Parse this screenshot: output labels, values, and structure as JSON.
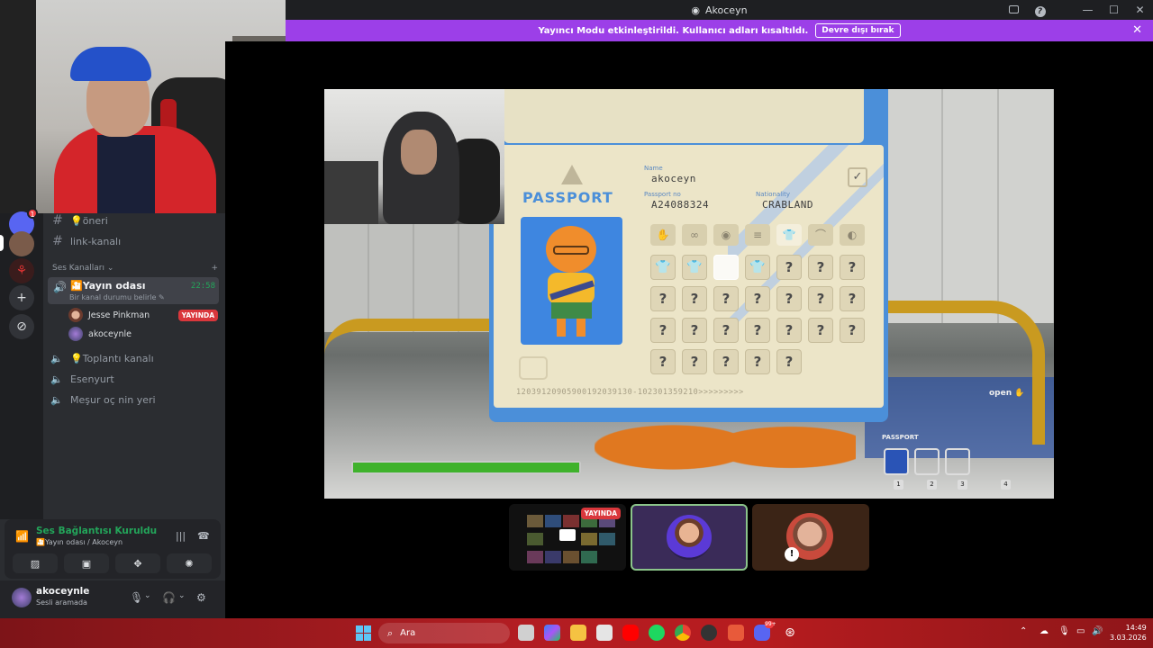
{
  "window": {
    "title": "Akoceyn",
    "banner_text": "Yayıncı Modu etkinleştirildi. Kullanıcı adları kısaltıldı.",
    "banner_button": "Devre dışı bırak"
  },
  "servers": {
    "badge_count": "1"
  },
  "channels": {
    "text_items": [
      {
        "label": "💡öneri"
      },
      {
        "label": "link-kanalı"
      }
    ],
    "voice_section": "Ses Kanalları",
    "active": {
      "name": "🎦Yayın odası",
      "status": "Bir kanal durumu belirle",
      "timer": "22:58"
    },
    "members": [
      {
        "name": "Jesse Pinkman",
        "badge": "YAYINDA"
      },
      {
        "name": "akoceynle",
        "badge": ""
      }
    ],
    "other_voice": [
      {
        "label": "💡Toplantı kanalı"
      },
      {
        "label": "Esenyurt"
      },
      {
        "label": "Meşur oç nin yeri"
      }
    ]
  },
  "voice_panel": {
    "title": "Ses Bağlantısı Kuruldu",
    "subtitle": "🎦Yayın odası / Akoceyn"
  },
  "user": {
    "name": "akoceynle",
    "status": "Sesli aramada"
  },
  "game": {
    "passport": {
      "title": "PASSPORT",
      "name_label": "Name",
      "name_value": "akoceyn",
      "passport_no_label": "Passport no",
      "passport_no_value": "A24088324",
      "nationality_label": "Nationality",
      "nationality_value": "CRABLAND",
      "number_strip": "12039120905900192039130-102301359210>>>>>>>>>"
    },
    "hud": {
      "open_label": "open",
      "passport_label": "PASSPORT",
      "slots": [
        "1",
        "2",
        "3",
        "4"
      ],
      "progress": 1.0
    }
  },
  "stream_tiles": {
    "live_badge": "YAYINDA"
  },
  "taskbar": {
    "search_placeholder": "Ara",
    "time": "14:49",
    "date": "3.03.2026",
    "discord_badge": "99+"
  },
  "colors": {
    "banner": "#9c3fe8",
    "discord_green": "#23a55a",
    "live_red": "#da373c",
    "passport_blue": "#4b8fd9"
  }
}
